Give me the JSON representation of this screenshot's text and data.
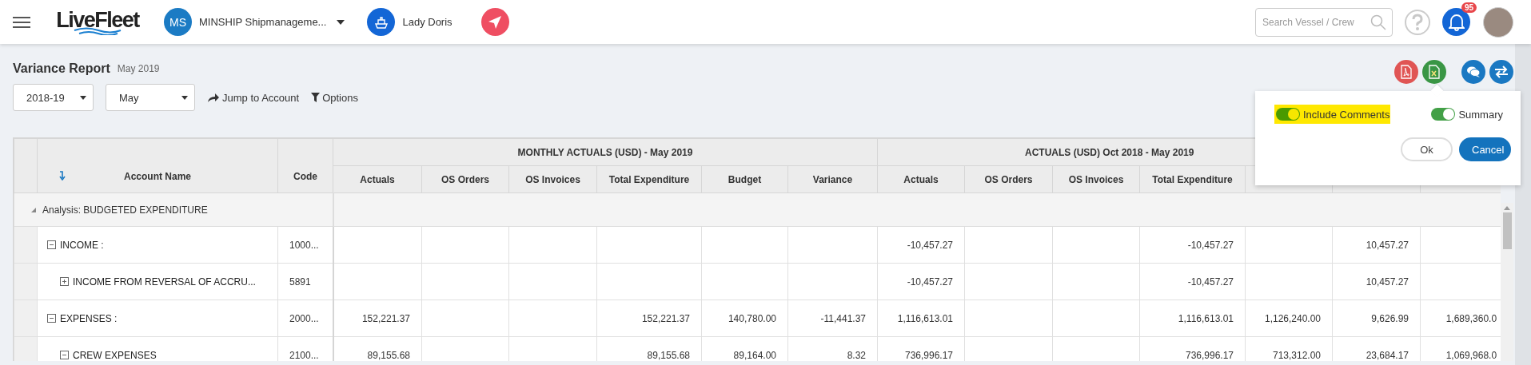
{
  "header": {
    "logo": "LiveFleet",
    "company": {
      "initials": "MS",
      "name": "MINSHIP Shipmanageme..."
    },
    "vessel": "Lady Doris",
    "search": {
      "placeholder": "Search Vessel / Crew"
    },
    "notifications": {
      "count": "95"
    }
  },
  "report": {
    "title": "Variance Report",
    "period": "May 2019",
    "year_select": "2018-19",
    "month_select": "May",
    "actions": [
      {
        "label": "Jump to Account",
        "kind": "jump"
      },
      {
        "label": "Options",
        "kind": "filter"
      }
    ]
  },
  "export_popup": {
    "toggles": [
      {
        "label": "Include Comments",
        "on": true,
        "highlighted": true
      },
      {
        "label": "Summary",
        "on": true,
        "highlighted": false
      }
    ],
    "buttons": [
      {
        "label": "Ok",
        "kind": "secondary"
      },
      {
        "label": "Cancel",
        "kind": "primary"
      }
    ]
  },
  "table": {
    "account_header": "Account Name",
    "code_header": "Code",
    "groups": [
      {
        "title": "MONTHLY ACTUALS (USD) - May 2019",
        "columns": [
          "Actuals",
          "OS Orders",
          "OS Invoices",
          "Total Expenditure",
          "Budget",
          "Variance"
        ]
      },
      {
        "title": "ACTUALS (USD) Oct 2018 - May 2019",
        "columns": [
          "Actuals",
          "OS Orders",
          "OS Invoices",
          "Total Expenditure"
        ]
      }
    ],
    "analysis": {
      "label": "Analysis: BUDGETED EXPENDITURE",
      "expanded": true,
      "rows": [
        {
          "name": "INCOME :",
          "code": "1000...",
          "expanded": true,
          "cells": [
            {
              "empty": true
            },
            {
              "empty": true
            },
            {
              "empty": true
            },
            {
              "empty": true
            },
            {
              "empty": true
            },
            {
              "empty": true
            },
            {
              "value": "-10,457.27"
            },
            {
              "empty": true
            },
            {
              "empty": true
            },
            {
              "value": "-10,457.27"
            },
            {
              "empty": true
            },
            {
              "value": "10,457.27"
            },
            {
              "empty": true
            }
          ],
          "children": [
            {
              "name": "INCOME FROM REVERSAL OF ACCRU...",
              "code": "5891",
              "expanded": false,
              "cells": [
                {
                  "empty": true
                },
                {
                  "empty": true
                },
                {
                  "empty": true
                },
                {
                  "empty": true
                },
                {
                  "empty": true
                },
                {
                  "empty": true
                },
                {
                  "value": "-10,457.27"
                },
                {
                  "empty": true
                },
                {
                  "empty": true
                },
                {
                  "value": "-10,457.27"
                },
                {
                  "empty": true
                },
                {
                  "value": "10,457.27"
                },
                {
                  "empty": true
                }
              ]
            }
          ]
        },
        {
          "name": "EXPENSES :",
          "code": "2000...",
          "expanded": true,
          "cells": [
            {
              "value": "152,221.37"
            },
            {
              "empty": true
            },
            {
              "empty": true
            },
            {
              "value": "152,221.37"
            },
            {
              "value": "140,780.00"
            },
            {
              "value": "-11,441.37"
            },
            {
              "value": "1,116,613.01"
            },
            {
              "empty": true
            },
            {
              "empty": true
            },
            {
              "value": "1,116,613.01"
            },
            {
              "value": "1,126,240.00"
            },
            {
              "value": "9,626.99"
            },
            {
              "value": "1,689,360.0"
            }
          ],
          "children": [
            {
              "name": "CREW EXPENSES",
              "code": "2100...",
              "expanded": true,
              "cells": [
                {
                  "value": "89,155.68"
                },
                {
                  "empty": true
                },
                {
                  "empty": true
                },
                {
                  "value": "89,155.68"
                },
                {
                  "value": "89,164.00"
                },
                {
                  "value": "8.32"
                },
                {
                  "value": "736,996.17"
                },
                {
                  "empty": true
                },
                {
                  "empty": true
                },
                {
                  "value": "736,996.17"
                },
                {
                  "value": "713,312.00"
                },
                {
                  "value": "23,684.17"
                },
                {
                  "value": "1,069,968.0"
                }
              ]
            }
          ]
        }
      ]
    }
  }
}
